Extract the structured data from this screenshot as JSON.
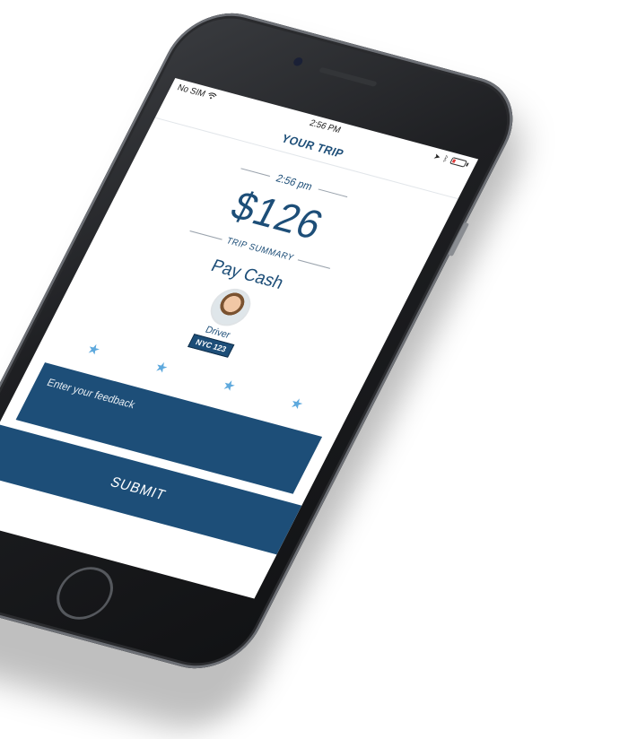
{
  "status_bar": {
    "carrier": "No SIM",
    "time": "2:56 PM",
    "icons": [
      "wifi-icon",
      "location-arrow-icon",
      "bluetooth-icon",
      "battery-low-icon"
    ]
  },
  "navbar": {
    "title": "YOUR TRIP"
  },
  "trip": {
    "time": "2:56 pm",
    "amount": "$126",
    "summary_label": "TRIP SUMMARY",
    "payment_method": "Pay Cash"
  },
  "driver": {
    "label": "Driver",
    "plate": "NYC 123"
  },
  "rating": {
    "stars": [
      "★",
      "★",
      "★",
      "★"
    ],
    "star_color": "#5ea9dd"
  },
  "feedback": {
    "placeholder": "Enter your feedback"
  },
  "submit": {
    "label": "SUBMIT"
  },
  "colors": {
    "primary": "#1d4e78",
    "accent": "#5ea9dd",
    "battery_low": "#e23b3b"
  }
}
